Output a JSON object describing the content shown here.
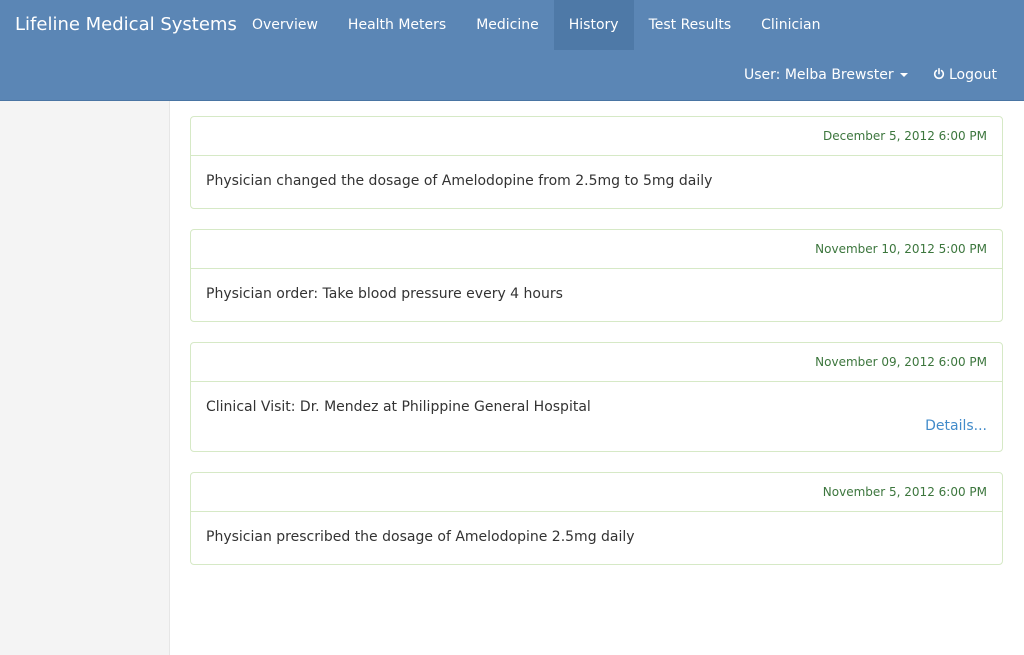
{
  "app": {
    "brand": "Lifeline Medical Systems"
  },
  "nav": {
    "items": [
      {
        "label": "Overview"
      },
      {
        "label": "Health Meters"
      },
      {
        "label": "Medicine"
      },
      {
        "label": "History"
      },
      {
        "label": "Test Results"
      },
      {
        "label": "Clinician"
      }
    ],
    "active": "History"
  },
  "user_menu": {
    "label": "User: Melba Brewster"
  },
  "logout": {
    "label": "Logout"
  },
  "history": [
    {
      "date": "December 5, 2012 6:00 PM",
      "text": "Physician changed the dosage of Amelodopine from 2.5mg to 5mg daily"
    },
    {
      "date": "November 10, 2012 5:00 PM",
      "text": "Physician order: Take blood pressure every 4 hours"
    },
    {
      "date": "November 09, 2012 6:00 PM",
      "text": "Clinical Visit: Dr. Mendez at Philippine General Hospital",
      "link": "Details..."
    },
    {
      "date": "November 5, 2012 6:00 PM",
      "text": "Physician prescribed the dosage of Amelodopine 2.5mg daily"
    }
  ],
  "colors": {
    "navbar": "#5b86b5",
    "active_tab": "#4e79a7",
    "panel_border": "#d6e9c6",
    "date_text": "#3c763d",
    "link": "#428bca"
  }
}
